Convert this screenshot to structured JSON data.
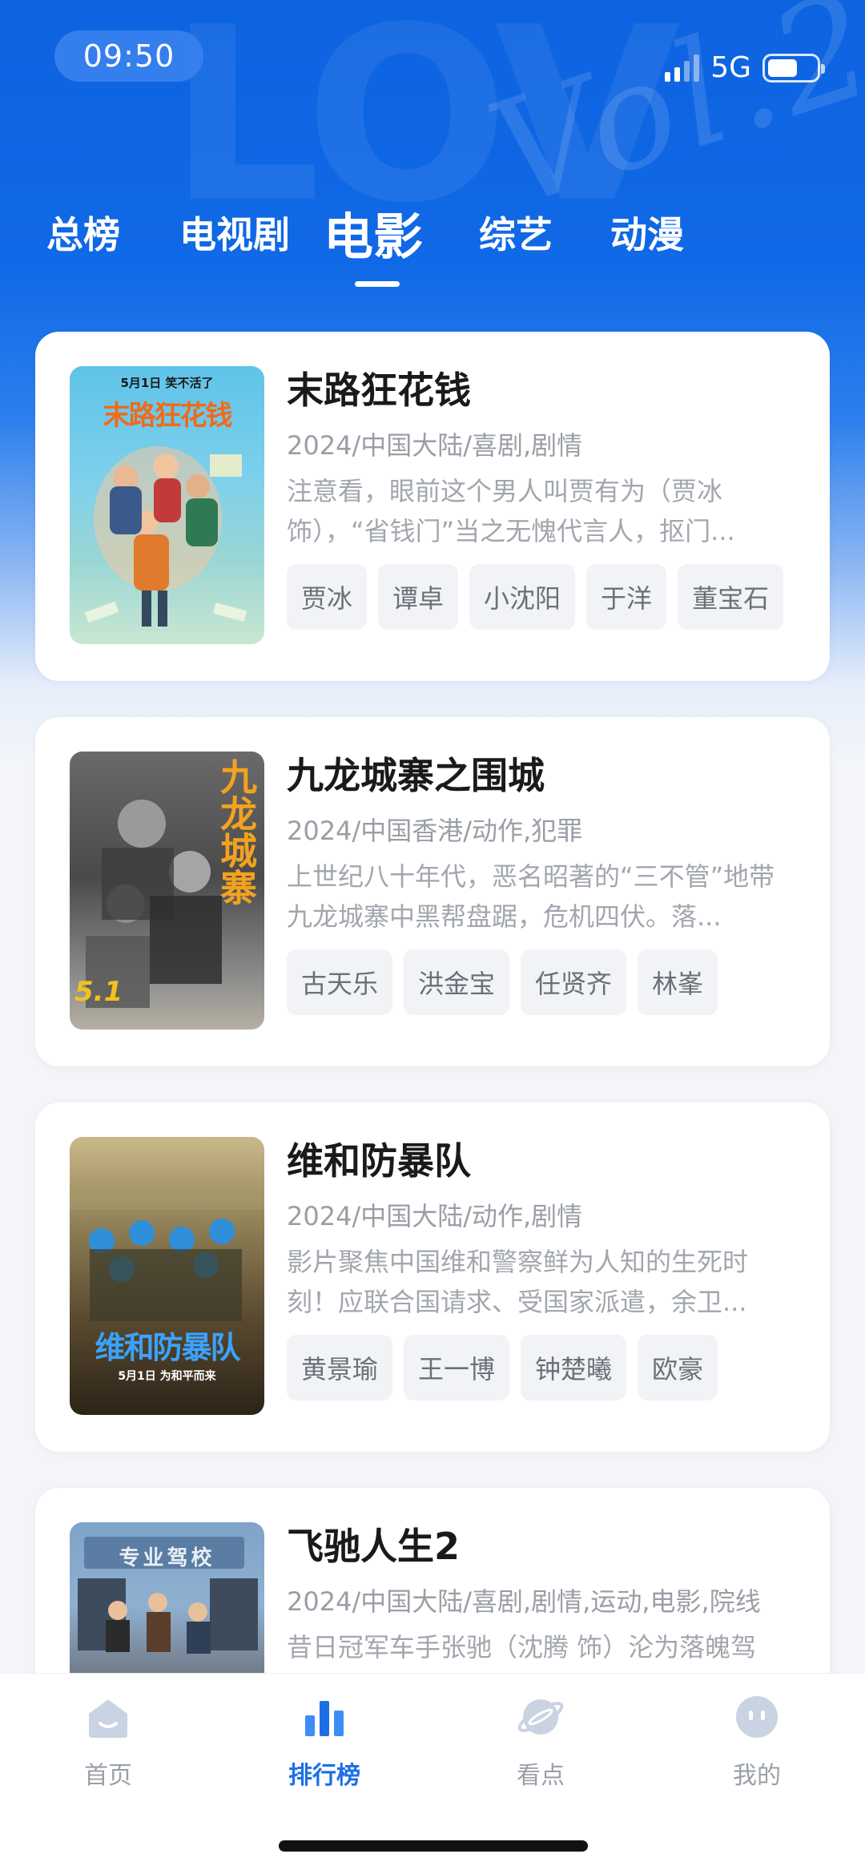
{
  "status_bar": {
    "time": "09:50",
    "network": "5G"
  },
  "tabs": [
    {
      "label": "总榜"
    },
    {
      "label": "电视剧"
    },
    {
      "label": "电影",
      "active": true
    },
    {
      "label": "综艺"
    },
    {
      "label": "动漫"
    }
  ],
  "movies": [
    {
      "title": "末路狂花钱",
      "meta": "2024/中国大陆/喜剧,剧情",
      "description": "注意看，眼前这个男人叫贾有为（贾冰饰），“省钱门”当之无愧代言人，抠门...",
      "cast": [
        "贾冰",
        "谭卓",
        "小沈阳",
        "于洋",
        "董宝石"
      ],
      "poster": {
        "caption": "5月1日 笑不活了",
        "title_art": "末路狂花钱"
      }
    },
    {
      "title": "九龙城寨之围城",
      "meta": "2024/中国香港/动作,犯罪",
      "description": "上世纪八十年代，恶名昭著的“三不管”地带九龙城寨中黑帮盘踞，危机四伏。落...",
      "cast": [
        "古天乐",
        "洪金宝",
        "任贤齐",
        "林峯"
      ],
      "poster": {
        "title_art": "九龙城寨",
        "caption": "5.1"
      }
    },
    {
      "title": "维和防暴队",
      "meta": "2024/中国大陆/动作,剧情",
      "description": "影片聚焦中国维和警察鲜为人知的生死时刻！应联合国请求、受国家派遣，余卫...",
      "cast": [
        "黄景瑜",
        "王一博",
        "钟楚曦",
        "欧豪"
      ],
      "poster": {
        "title_art": "维和防暴队",
        "caption": "5月1日 为和平而来"
      }
    },
    {
      "title": "飞驰人生2",
      "meta": "2024/中国大陆/喜剧,剧情,运动,电影,院线",
      "description": "昔日冠军车手张驰（沈腾 饰）沦为落魄驾",
      "cast": [],
      "poster": {
        "caption": "专业驾校"
      }
    }
  ],
  "bottom_nav": [
    {
      "label": "首页"
    },
    {
      "label": "排行榜",
      "active": true
    },
    {
      "label": "看点"
    },
    {
      "label": "我的"
    }
  ],
  "colors": {
    "accent": "#1e6fe6",
    "header_blue": "#0d63e0"
  }
}
